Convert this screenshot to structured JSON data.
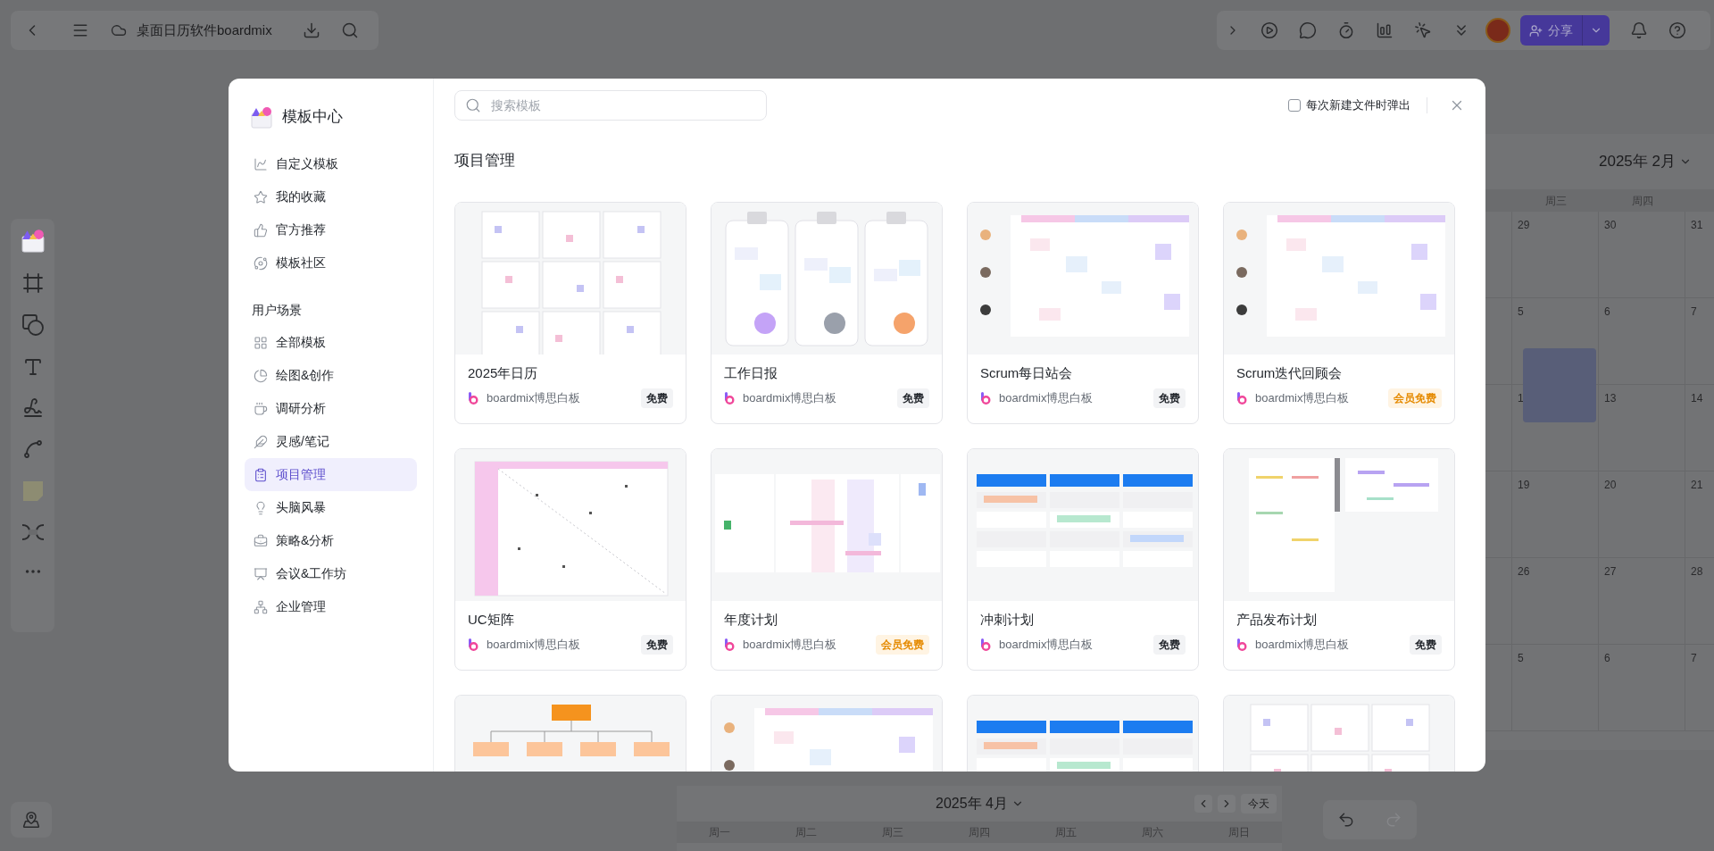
{
  "toolbar": {
    "title": "桌面日历软件boardmix"
  },
  "topbar_right": {
    "share_label": "分享"
  },
  "modal": {
    "brand": "模板中心",
    "nav": [
      {
        "label": "自定义模板",
        "selected": false
      },
      {
        "label": "我的收藏",
        "selected": false
      },
      {
        "label": "官方推荐",
        "selected": false
      },
      {
        "label": "模板社区",
        "selected": false
      }
    ],
    "section_label": "用户场景",
    "categories": [
      {
        "label": "全部模板",
        "selected": false
      },
      {
        "label": "绘图&创作",
        "selected": false
      },
      {
        "label": "调研分析",
        "selected": false
      },
      {
        "label": "灵感/笔记",
        "selected": false
      },
      {
        "label": "项目管理",
        "selected": true
      },
      {
        "label": "头脑风暴",
        "selected": false
      },
      {
        "label": "策略&分析",
        "selected": false
      },
      {
        "label": "会议&工作坊",
        "selected": false
      },
      {
        "label": "企业管理",
        "selected": false
      }
    ],
    "search": {
      "placeholder": "搜索模板"
    },
    "popup_option": {
      "label": "每次新建文件时弹出",
      "checked": false
    },
    "heading": "项目管理",
    "cards": [
      {
        "title": "2025年日历",
        "author": "boardmix博思白板",
        "badge": {
          "text": "免费",
          "kind": "free"
        }
      },
      {
        "title": "工作日报",
        "author": "boardmix博思白板",
        "badge": {
          "text": "免费",
          "kind": "free"
        }
      },
      {
        "title": "Scrum每日站会",
        "author": "boardmix博思白板",
        "badge": {
          "text": "免费",
          "kind": "free"
        }
      },
      {
        "title": "Scrum迭代回顾会",
        "author": "boardmix博思白板",
        "badge": {
          "text": "会员免费",
          "kind": "member"
        }
      },
      {
        "title": "UC矩阵",
        "author": "boardmix博思白板",
        "badge": {
          "text": "免费",
          "kind": "free"
        }
      },
      {
        "title": "年度计划",
        "author": "boardmix博思白板",
        "badge": {
          "text": "会员免费",
          "kind": "member"
        }
      },
      {
        "title": "冲刺计划",
        "author": "boardmix博思白板",
        "badge": {
          "text": "免费",
          "kind": "free"
        }
      },
      {
        "title": "产品发布计划",
        "author": "boardmix博思白板",
        "badge": {
          "text": "免费",
          "kind": "free"
        }
      }
    ]
  },
  "calendar_feb": {
    "title": "2025年 2月",
    "weekdays": [
      "周三",
      "周四"
    ],
    "rows": [
      [
        "29",
        "30",
        "31"
      ],
      [
        "5",
        "6",
        "7"
      ],
      [
        "1",
        "13",
        "14"
      ],
      [
        "19",
        "20",
        "21"
      ],
      [
        "26",
        "27",
        "28"
      ],
      [
        "5",
        "6",
        "7"
      ]
    ]
  },
  "calendar_apr": {
    "title": "2025年 4月",
    "today": "今天",
    "weekdays": [
      "周一",
      "周二",
      "周三",
      "周四",
      "周五",
      "周六",
      "周日"
    ]
  }
}
